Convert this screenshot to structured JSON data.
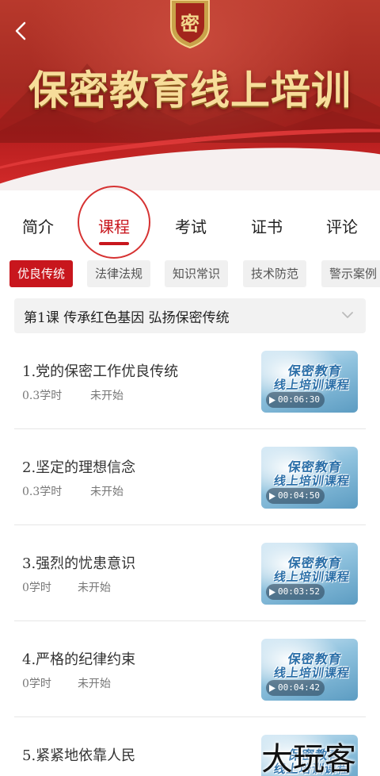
{
  "banner": {
    "title": "保密教育线上培训",
    "emblem_glyph": "密",
    "colors": {
      "bg": "#b51e1e",
      "title": "#f7dd9a"
    }
  },
  "nav": {
    "back_icon": "chevron-left-icon"
  },
  "tabs": [
    {
      "label": "简介",
      "active": false
    },
    {
      "label": "课程",
      "active": true
    },
    {
      "label": "考试",
      "active": false
    },
    {
      "label": "证书",
      "active": false
    },
    {
      "label": "评论",
      "active": false
    }
  ],
  "categories": [
    {
      "label": "优良传统",
      "active": true
    },
    {
      "label": "法律法规",
      "active": false
    },
    {
      "label": "知识常识",
      "active": false
    },
    {
      "label": "技术防范",
      "active": false
    },
    {
      "label": "警示案例",
      "active": false
    }
  ],
  "lesson": {
    "title": "第1课  传承红色基因  弘扬保密传统",
    "toggle_icon": "chevron-down-icon"
  },
  "courses": [
    {
      "title": "1.党的保密工作优良传统",
      "hours": "0.3学时",
      "status": "未开始",
      "duration": "00:06:30",
      "thumb_line1": "保密教育",
      "thumb_line2": "线上培训课程"
    },
    {
      "title": "2.坚定的理想信念",
      "hours": "0.3学时",
      "status": "未开始",
      "duration": "00:04:50",
      "thumb_line1": "保密教育",
      "thumb_line2": "线上培训课程"
    },
    {
      "title": "3.强烈的忧患意识",
      "hours": "0学时",
      "status": "未开始",
      "duration": "00:03:52",
      "thumb_line1": "保密教育",
      "thumb_line2": "线上培训课程"
    },
    {
      "title": "4.严格的纪律约束",
      "hours": "0学时",
      "status": "未开始",
      "duration": "00:04:42",
      "thumb_line1": "保密教育",
      "thumb_line2": "线上培训课程"
    },
    {
      "title": "5.紧紧地依靠人民",
      "hours": "",
      "status": "",
      "duration": "",
      "thumb_line1": "保密教育",
      "thumb_line2": "线上培训课程"
    }
  ],
  "watermark": "大玩客",
  "colors": {
    "accent": "#c8161d",
    "chip_bg": "#f0f0f0",
    "lesson_bg": "#f2f2f2"
  }
}
